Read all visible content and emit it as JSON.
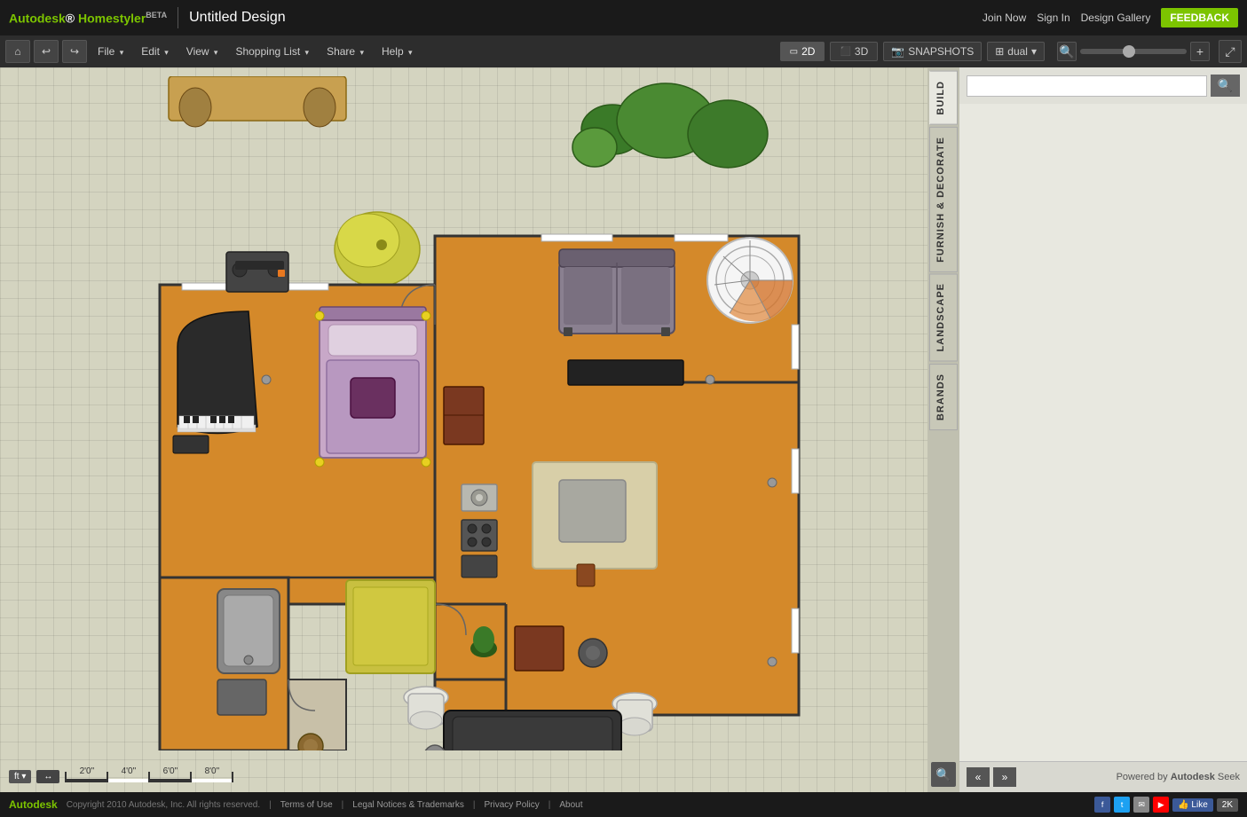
{
  "app": {
    "name": "Autodesk",
    "product": "Homestyler",
    "beta": "BETA",
    "title": "Untitled Design"
  },
  "topbar": {
    "join_now": "Join Now",
    "sign_in": "Sign In",
    "design_gallery": "Design Gallery",
    "feedback": "FEEDBACK"
  },
  "menu": {
    "file": "File",
    "edit": "Edit",
    "view": "View",
    "shopping_list": "Shopping List",
    "share": "Share",
    "help": "Help",
    "view_2d": "2D",
    "view_3d": "3D",
    "snapshots": "SNAPSHOTS",
    "dual": "dual"
  },
  "panel": {
    "tabs": [
      "BUILD",
      "FURNISH & DECORATE",
      "LANDSCAPE",
      "BRANDS"
    ],
    "search_placeholder": "",
    "powered_by": "Powered by Autodesk Seek"
  },
  "scale": {
    "unit": "ft",
    "marks": [
      "2'0\"",
      "4'0\"",
      "6'0\"",
      "8'0\""
    ]
  },
  "footer": {
    "brand": "Autodesk",
    "copyright": "Copyright 2010 Autodesk, Inc. All rights reserved.",
    "terms": "Terms of Use",
    "legal": "Legal Notices & Trademarks",
    "privacy": "Privacy Policy",
    "about": "About",
    "like": "Like",
    "k2": "2K"
  }
}
